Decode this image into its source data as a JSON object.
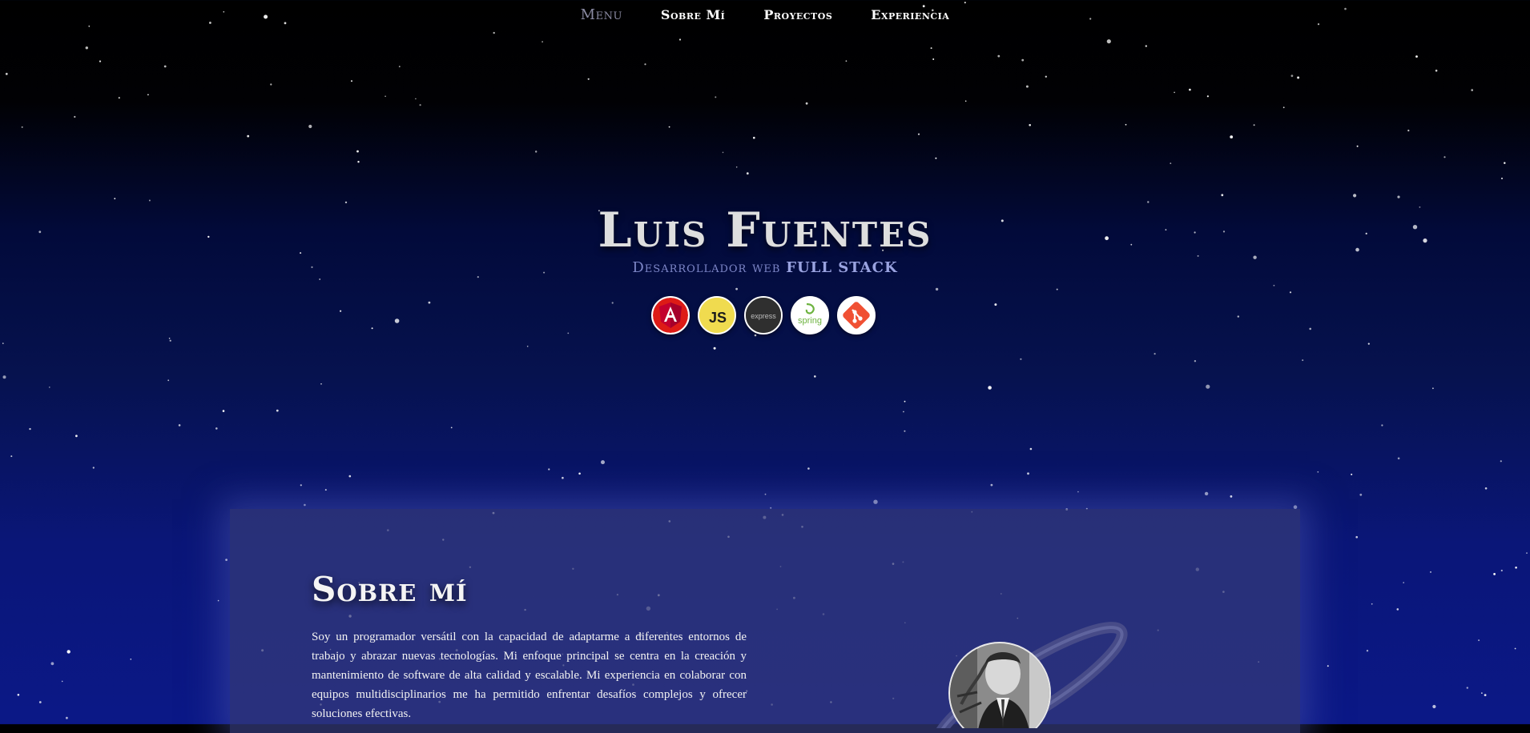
{
  "nav": {
    "menu_label": "Menu",
    "items": [
      {
        "label": "Sobre Mí"
      },
      {
        "label": "Proyectos"
      },
      {
        "label": "Experiencia"
      }
    ]
  },
  "hero": {
    "name": "Luis Fuentes",
    "role_prefix": "Desarrollador web",
    "role_highlight": "FULL STACK",
    "techs": [
      {
        "icon": "angular-icon",
        "label": "A",
        "bg": "#dd1b16",
        "fg": "#ffffff"
      },
      {
        "icon": "javascript-icon",
        "label": "JS",
        "bg": "#f0db4f",
        "fg": "#1b1b1b"
      },
      {
        "icon": "express-icon",
        "label": "express",
        "bg": "#2f2f2f",
        "fg": "#bdbdbd"
      },
      {
        "icon": "spring-icon",
        "label": "spring",
        "bg": "#ffffff",
        "fg": "#6db33f"
      },
      {
        "icon": "git-icon",
        "label": "",
        "bg": "#f05033",
        "fg": "#ffffff"
      }
    ]
  },
  "about": {
    "title": "Sobre mí",
    "text": "Soy un programador versátil con la capacidad de adaptarme a diferentes entornos de trabajo y abrazar nuevas tecnologías. Mi enfoque principal se centra en la creación y mantenimiento de software de alta calidad y escalable. Mi experiencia en colaborar con equipos multidisciplinarios me ha permitido enfrentar desafíos complejos y ofrecer soluciones efectivas."
  },
  "colors": {
    "accent": "#9aa3e0",
    "card_bg": "#343a7a"
  }
}
